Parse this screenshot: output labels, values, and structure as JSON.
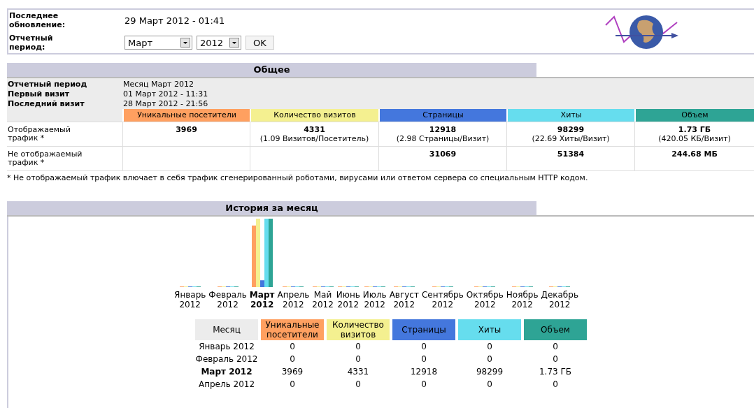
{
  "header": {
    "last_update_label": "Последнее обновление:",
    "last_update_value": "29 Март 2012 - 01:41",
    "period_label": "Отчетный период:",
    "month_select": {
      "value": "Март"
    },
    "year_select": {
      "value": "2012"
    },
    "ok_button": "OK"
  },
  "summary": {
    "title": "Общее",
    "info": [
      {
        "label": "Отчетный период",
        "value": "Месяц Март 2012"
      },
      {
        "label": "Первый визит",
        "value": "01 Март 2012 - 11:31"
      },
      {
        "label": "Последний визит",
        "value": "28 Март 2012 - 21:56"
      }
    ],
    "columns": [
      {
        "label": "Уникальные посетители",
        "color": "#ffa060"
      },
      {
        "label": "Количество визитов",
        "color": "#f4f090"
      },
      {
        "label": "Страницы",
        "color": "#4477dd"
      },
      {
        "label": "Хиты",
        "color": "#66ddee"
      },
      {
        "label": "Объем",
        "color": "#2ea495"
      }
    ],
    "rows": [
      {
        "label": "Отображаемый трафик *",
        "cells": [
          {
            "main": "3969"
          },
          {
            "main": "4331",
            "sub": "(1.09 Визитов/Посетитель)"
          },
          {
            "main": "12918",
            "sub": "(2.98 Страницы/Визит)"
          },
          {
            "main": "98299",
            "sub": "(22.69 Хиты/Визит)"
          },
          {
            "main": "1.73 ГБ",
            "sub": "(420.05 КБ/Визит)"
          }
        ]
      },
      {
        "label": "Не отображаемый трафик *",
        "cells": [
          {},
          {},
          {
            "main": "31069"
          },
          {
            "main": "51384"
          },
          {
            "main": "244.68 МБ"
          }
        ]
      }
    ],
    "footnote": "* Не отображаемый трафик влючает в себя трафик сгенерированный роботами, вирусами или ответом сервера со специальным HTTP кодом."
  },
  "history": {
    "title": "История за месяц",
    "chart": {
      "months": [
        {
          "month": "Январь",
          "year": "2012",
          "selected": false
        },
        {
          "month": "Февраль",
          "year": "2012",
          "selected": false
        },
        {
          "month": "Март",
          "year": "2012",
          "selected": true
        },
        {
          "month": "Апрель",
          "year": "2012",
          "selected": false
        },
        {
          "month": "Май",
          "year": "2012",
          "selected": false
        },
        {
          "month": "Июнь",
          "year": "2012",
          "selected": false
        },
        {
          "month": "Июль",
          "year": "2012",
          "selected": false
        },
        {
          "month": "Август",
          "year": "2012",
          "selected": false
        },
        {
          "month": "Сентябрь",
          "year": "2012",
          "selected": false
        },
        {
          "month": "Октябрь",
          "year": "2012",
          "selected": false
        },
        {
          "month": "Ноябрь",
          "year": "2012",
          "selected": false
        },
        {
          "month": "Декабрь",
          "year": "2012",
          "selected": false
        }
      ]
    },
    "table": {
      "columns": [
        {
          "label": "Месяц"
        },
        {
          "label": "Уникальные посетители",
          "color": "#ffa060"
        },
        {
          "label": "Количество визитов",
          "color": "#f4f090"
        },
        {
          "label": "Страницы",
          "color": "#4477dd"
        },
        {
          "label": "Хиты",
          "color": "#66ddee"
        },
        {
          "label": "Объем",
          "color": "#2ea495"
        }
      ],
      "rows": [
        {
          "month": "Январь 2012",
          "selected": false,
          "values": [
            "0",
            "0",
            "0",
            "0",
            "0"
          ]
        },
        {
          "month": "Февраль 2012",
          "selected": false,
          "values": [
            "0",
            "0",
            "0",
            "0",
            "0"
          ]
        },
        {
          "month": "Март 2012",
          "selected": true,
          "values": [
            "3969",
            "4331",
            "12918",
            "98299",
            "1.73 ГБ"
          ]
        },
        {
          "month": "Апрель 2012",
          "selected": false,
          "values": [
            "0",
            "0",
            "0",
            "0",
            "0"
          ]
        }
      ]
    }
  }
}
